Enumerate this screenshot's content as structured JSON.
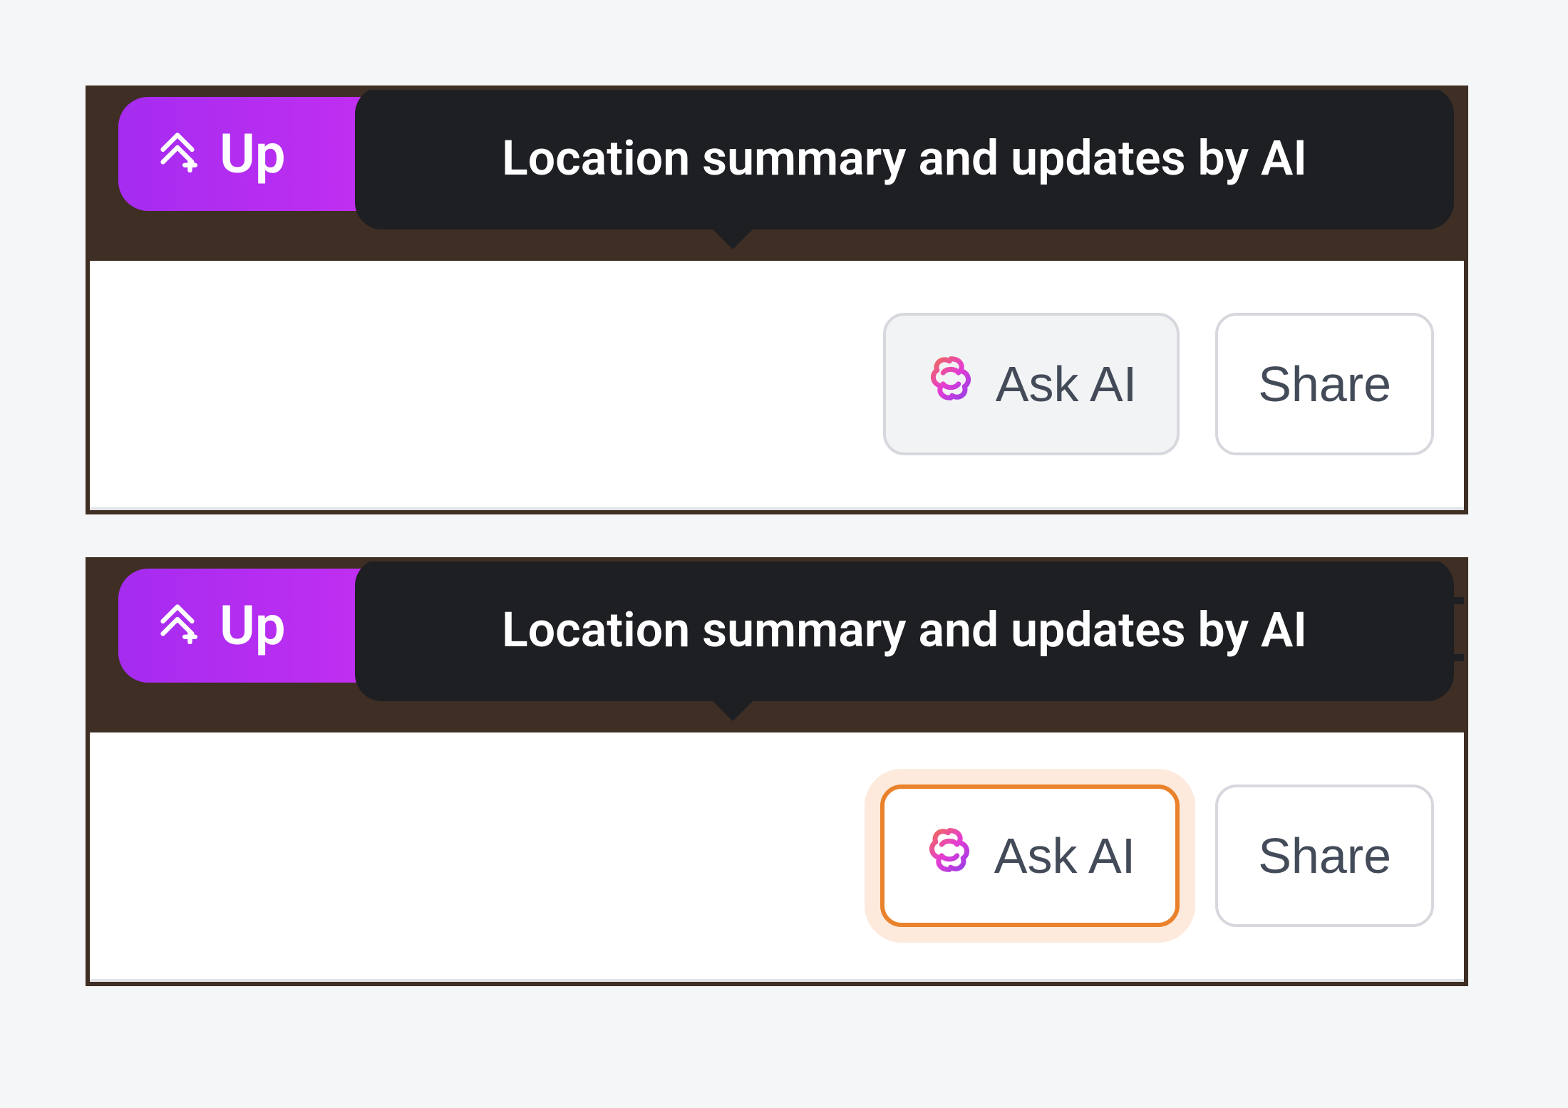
{
  "upgrade": {
    "label": "Up"
  },
  "tooltip": {
    "text": "Location summary and updates by AI"
  },
  "actions": {
    "ask_ai": "Ask AI",
    "share": "Share"
  }
}
